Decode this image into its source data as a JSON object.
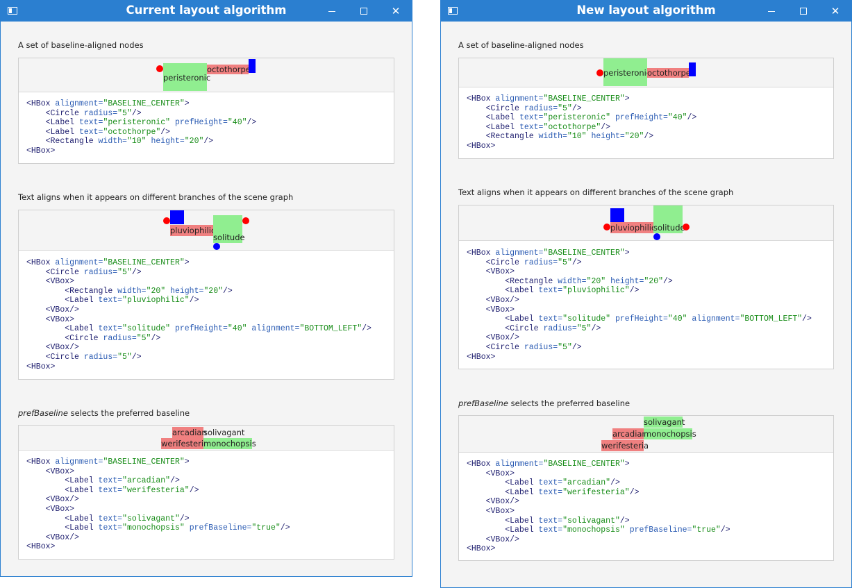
{
  "windows": {
    "left": {
      "title": "Current layout algorithm"
    },
    "right": {
      "title": "New layout algorithm"
    }
  },
  "captions": {
    "s1": "A set of baseline-aligned nodes",
    "s2": "Text aligns when it appears on different branches of the scene graph",
    "s3_em": "prefBaseline",
    "s3_rest": " selects the preferred baseline"
  },
  "labels": {
    "peristeronic": "peristeronic",
    "octothorpe": "octothorpe",
    "pluviophilic": "pluviophilic",
    "solitude": "solitude",
    "arcadian": "arcadian",
    "werifesteria": "werifesteria",
    "solivagant": "solivagant",
    "monochopsis": "monochopsis"
  },
  "code": {
    "hbox_open": "<HBox",
    "hbox_close": "<HBox>",
    "vbox_open": "<VBox>",
    "vbox_close": "<VBox/>",
    "alignment_attr": "alignment=",
    "alignment_val": "\"BASELINE_CENTER\"",
    "gt": ">",
    "selfclose": "/>",
    "circle": "<Circle",
    "label": "<Label",
    "rectangle": "<Rectangle",
    "radius_attr": "radius=",
    "radius_val": "\"5\"",
    "text_attr": "text=",
    "pref_height_attr": "prefHeight=",
    "pref_height_val": "\"40\"",
    "width_attr": "width=",
    "height_attr": "height=",
    "w10": "\"10\"",
    "h20": "\"20\"",
    "w20": "\"20\"",
    "bottom_left_val": "\"BOTTOM_LEFT\"",
    "pref_baseline_attr": "prefBaseline=",
    "true_val": "\"true\"",
    "q_peristeronic": "\"peristeronic\"",
    "q_octothorpe": "\"octothorpe\"",
    "q_pluviophilic": "\"pluviophilic\"",
    "q_solitude": "\"solitude\"",
    "q_arcadian": "\"arcadian\"",
    "q_werifesteria": "\"werifesteria\"",
    "q_solivagant": "\"solivagant\"",
    "q_monochopsis": "\"monochopsis\""
  },
  "colors": {
    "titlebar": "#2b7fd0",
    "label_green": "#90ee90",
    "label_pink": "#f08080",
    "rect_blue": "#0000ff",
    "circle_red": "#ff0000",
    "circle_blue": "#0000ff"
  },
  "icons": [
    "app-window-icon",
    "minimize-icon",
    "maximize-icon",
    "close-icon"
  ]
}
